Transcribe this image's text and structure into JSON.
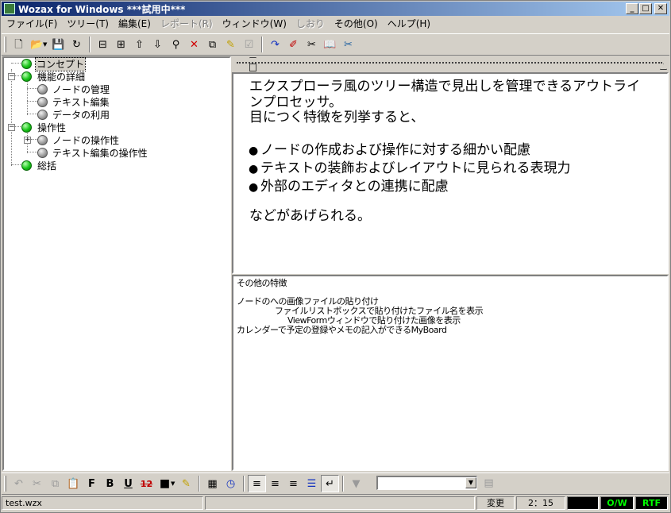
{
  "window": {
    "title": "Wozax for Windows ***試用中***",
    "min_glyph": "_",
    "max_glyph": "□",
    "close_glyph": "✕"
  },
  "menu": {
    "items": [
      {
        "label": "ファイル(F)",
        "disabled": false
      },
      {
        "label": "ツリー(T)",
        "disabled": false
      },
      {
        "label": "編集(E)",
        "disabled": false
      },
      {
        "label": "レポート(R)",
        "disabled": true
      },
      {
        "label": "ウィンドウ(W)",
        "disabled": false
      },
      {
        "label": "しおり",
        "disabled": true
      },
      {
        "label": "その他(O)",
        "disabled": false
      },
      {
        "label": "ヘルプ(H)",
        "disabled": false
      }
    ]
  },
  "toolbar_top": {
    "new_glyph": "🗋",
    "open_glyph": "📂",
    "save_glyph": "💾",
    "refresh_glyph": "↻",
    "node_prev_glyph": "⊟",
    "node_next_glyph": "⊞",
    "up_glyph": "⇧",
    "down_glyph": "⇩",
    "find_glyph": "⚲",
    "delete_glyph": "✕",
    "copy_node_glyph": "⧉",
    "note_glyph": "✎",
    "check_glyph": "☑",
    "jump_glyph": "↷",
    "edit_glyph": "✐",
    "cut_node_glyph": "✂",
    "book_glyph": "📖",
    "tools_glyph": "✂"
  },
  "tree": {
    "nodes": [
      {
        "label": "コンセプト",
        "level": 0,
        "color": "green",
        "expander": "",
        "selected": true
      },
      {
        "label": "機能の詳細",
        "level": 0,
        "color": "green",
        "expander": "−",
        "selected": false
      },
      {
        "label": "ノードの管理",
        "level": 1,
        "color": "gray",
        "expander": "",
        "selected": false
      },
      {
        "label": "テキスト編集",
        "level": 1,
        "color": "gray",
        "expander": "",
        "selected": false
      },
      {
        "label": "データの利用",
        "level": 1,
        "color": "gray",
        "expander": "",
        "selected": false
      },
      {
        "label": "操作性",
        "level": 0,
        "color": "green",
        "expander": "−",
        "selected": false
      },
      {
        "label": "ノードの操作性",
        "level": 1,
        "color": "gray",
        "expander": "+",
        "selected": false
      },
      {
        "label": "テキスト編集の操作性",
        "level": 1,
        "color": "gray",
        "expander": "",
        "selected": false
      },
      {
        "label": "総括",
        "level": 0,
        "color": "green",
        "expander": "",
        "selected": false
      }
    ]
  },
  "document": {
    "lines": [
      "エクスプローラ風のツリー構造で見出しを管理できるアウトライ",
      "ンプロセッサ。",
      "目につく特徴を列挙すると、"
    ],
    "bullet_glyph": "●",
    "bullets": [
      "ノードの作成および操作に対する細かい配慮",
      "テキストの装飾およびレイアウトに見られる表現力",
      "外部のエディタとの連携に配慮"
    ],
    "closing": "などがあげられる。"
  },
  "memo": {
    "heading": "その他の特徴",
    "lines": [
      "ノードのへの画像ファイルの貼り付け",
      "ファイルリストボックスで貼り付けたファイル名を表示",
      "ViewFormウィンドウで貼り付けた画像を表示",
      "カレンダーで予定の登録やメモの記入ができるMyBoard"
    ]
  },
  "toolbar_bottom": {
    "undo_glyph": "↶",
    "cut_glyph": "✂",
    "copy_glyph": "⧉",
    "paste_glyph": "📋",
    "font_label": "F",
    "bold_label": "B",
    "underline_label": "U",
    "fontsize_label": "12",
    "color_glyph": "■",
    "highlight_glyph": "✎",
    "calendar_glyph": "▦",
    "clock_glyph": "◷",
    "align_left_glyph": "≡",
    "align_center_glyph": "≡",
    "align_right_glyph": "≡",
    "list_glyph": "☰",
    "wrap_glyph": "↵",
    "style_glyph": "▼",
    "style_value": "",
    "combo_arrow": "▼",
    "extra_glyph": "▤"
  },
  "status": {
    "filename": "test.wzx",
    "info": "",
    "modified": "変更",
    "position": "2：15",
    "mode": "",
    "ow": "O/W",
    "format": "RTF"
  }
}
